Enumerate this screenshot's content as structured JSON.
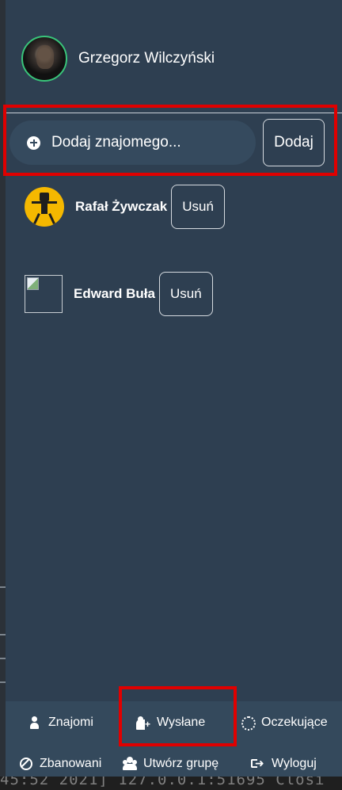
{
  "user": {
    "name": "Grzegorz Wilczyński",
    "avatar_icon": "profile-photo-avatar"
  },
  "add_friend": {
    "placeholder": "Dodaj znajomego...",
    "button_label": "Dodaj",
    "icon": "plus-circle-icon"
  },
  "friends": [
    {
      "name": "Rafał Żywczak",
      "remove_label": "Usuń",
      "avatar": "robot-avatar"
    },
    {
      "name": "Edward Buła",
      "remove_label": "Usuń",
      "avatar": "broken-image"
    }
  ],
  "nav": {
    "row1": [
      {
        "label": "Znajomi",
        "icon": "user-icon"
      },
      {
        "label": "Wysłane",
        "icon": "user-plus-icon"
      },
      {
        "label": "Oczekujące",
        "icon": "spinner-icon"
      }
    ],
    "row2": [
      {
        "label": "Zbanowani",
        "icon": "ban-icon"
      },
      {
        "label": "Utwórz grupę",
        "icon": "users-icon"
      },
      {
        "label": "Wyloguj",
        "icon": "sign-out-icon"
      }
    ]
  },
  "background_terminal": {
    "text": "45:52 2021] 127.0.0.1:51695 Closi"
  },
  "colors": {
    "panel": "#2e3f51",
    "nav_bg": "#34495c",
    "highlight": "#e00000",
    "online_ring": "#39c57a"
  }
}
